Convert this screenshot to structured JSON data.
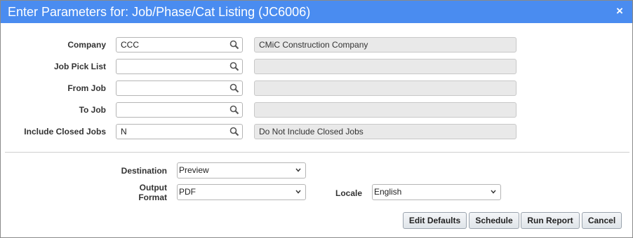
{
  "dialog": {
    "title": "Enter Parameters for: Job/Phase/Cat Listing (JC6006)",
    "close_glyph": "×"
  },
  "params": [
    {
      "label": "Company",
      "value": "CCC",
      "description": "CMiC Construction Company"
    },
    {
      "label": "Job Pick List",
      "value": "",
      "description": ""
    },
    {
      "label": "From Job",
      "value": "",
      "description": ""
    },
    {
      "label": "To Job",
      "value": "",
      "description": ""
    },
    {
      "label": "Include Closed Jobs",
      "value": "N",
      "description": "Do Not Include Closed Jobs"
    }
  ],
  "output": {
    "destination_label": "Destination",
    "destination_value": "Preview",
    "format_label_line1": "Output",
    "format_label_line2": "Format",
    "format_value": "PDF",
    "locale_label": "Locale",
    "locale_value": "English"
  },
  "buttons": {
    "edit_defaults": "Edit Defaults",
    "schedule": "Schedule",
    "run_report": "Run Report",
    "cancel": "Cancel"
  },
  "colors": {
    "title_bar": "#4a8cf0",
    "readonly_bg": "#e9e9e9"
  },
  "icons": {
    "lookup": "magnifier-icon",
    "dropdown": "chevron-down-icon",
    "close": "close-icon"
  }
}
